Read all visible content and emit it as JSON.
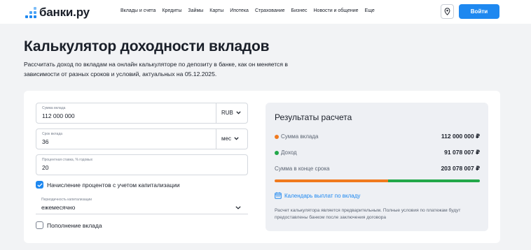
{
  "header": {
    "logo_text": "банки.ру",
    "nav": [
      "Вклады и счета",
      "Кредиты",
      "Займы",
      "Карты",
      "Ипотека",
      "Страхование",
      "Бизнес",
      "Новости и общение",
      "Еще"
    ],
    "login_label": "Войти"
  },
  "colors": {
    "accent": "#1e88f0",
    "deposit": "#f07a1e",
    "income": "#22a84a"
  },
  "page": {
    "title": "Калькулятор доходности вкладов",
    "subtitle": "Рассчитать доход по вкладам на онлайн калькуляторе по депозиту в банке, как он меняется в зависимости от разных сроков и условий, актуальных на 05.12.2025."
  },
  "form": {
    "amount": {
      "label": "Сумма вклада",
      "value": "112 000 000",
      "currency": "RUB"
    },
    "term": {
      "label": "Срок вклада",
      "value": "36",
      "unit": "мес"
    },
    "rate": {
      "label": "Процентная ставка, % годовых",
      "value": "20"
    },
    "capitalization": {
      "label": "Начисление процентов с учетом капитализации",
      "checked": true
    },
    "periodicity": {
      "label": "Периодичность капитализации",
      "value": "ежемесячно"
    },
    "replenishment": {
      "label": "Пополнение вклада",
      "checked": false
    }
  },
  "results": {
    "title": "Результаты расчета",
    "deposit": {
      "label": "Сумма вклада",
      "value": "112 000 000 ₽"
    },
    "income": {
      "label": "Доход",
      "value": "91 078 007 ₽"
    },
    "total": {
      "label": "Сумма в конце срока",
      "value": "203 078 007 ₽"
    },
    "deposit_share": 0.5515,
    "calendar_link": "Календарь выплат по вкладу",
    "disclaimer": "Расчет калькулятора является предварительным. Полные условия по платежам будут предоставлены банком после заключения договора"
  }
}
